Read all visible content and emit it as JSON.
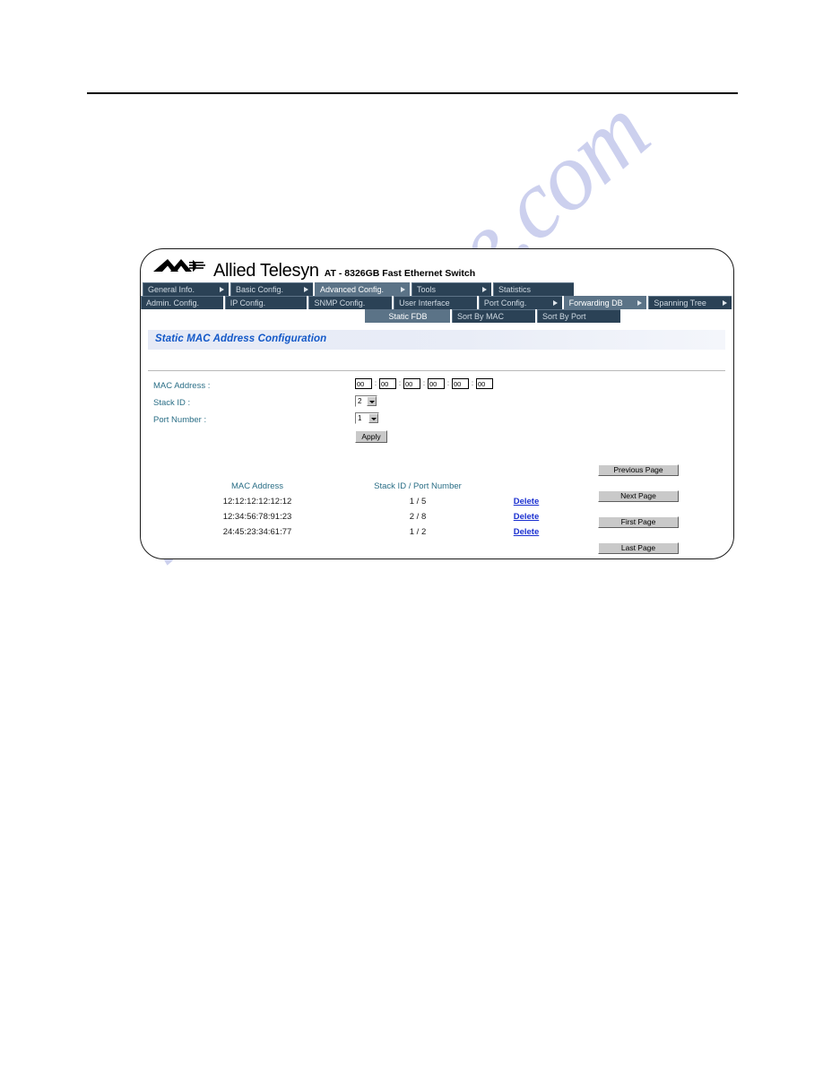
{
  "watermark": {
    "text": "manualshive.com"
  },
  "device": {
    "brand": "Allied Telesyn",
    "model": "AT - 8326GB Fast Ethernet Switch",
    "logo_icon": "allied-telesyn-logo-icon"
  },
  "nav": {
    "row1": [
      {
        "label": "General Info.",
        "selected": false,
        "arrow": true
      },
      {
        "label": "Basic Config.",
        "selected": false,
        "arrow": true
      },
      {
        "label": "Advanced Config.",
        "selected": true,
        "arrow": true
      },
      {
        "label": "Tools",
        "selected": false,
        "arrow": true
      },
      {
        "label": "Statistics",
        "selected": false,
        "arrow": false
      }
    ],
    "row2": [
      {
        "label": "Admin. Config.",
        "selected": false,
        "arrow": false
      },
      {
        "label": "IP Config.",
        "selected": false,
        "arrow": false
      },
      {
        "label": "SNMP Config.",
        "selected": false,
        "arrow": false
      },
      {
        "label": "User Interface",
        "selected": false,
        "arrow": false
      },
      {
        "label": "Port Config.",
        "selected": false,
        "arrow": true
      },
      {
        "label": "Forwarding DB",
        "selected": true,
        "arrow": true
      },
      {
        "label": "Spanning Tree",
        "selected": false,
        "arrow": true
      }
    ],
    "row3": [
      {
        "label": "Static FDB",
        "selected": true,
        "arrow": false
      },
      {
        "label": "Sort By MAC",
        "selected": false,
        "arrow": false
      },
      {
        "label": "Sort By Port",
        "selected": false,
        "arrow": false
      }
    ]
  },
  "page": {
    "title": "Static MAC Address Configuration"
  },
  "form": {
    "mac_label": "MAC Address :",
    "mac_octets": [
      "00",
      "00",
      "00",
      "00",
      "00",
      "00"
    ],
    "mac_separator": ":",
    "stack_label": "Stack ID :",
    "stack_value": "2",
    "port_label": "Port Number :",
    "port_value": "1",
    "apply_label": "Apply"
  },
  "table": {
    "headers": [
      "MAC Address",
      "Stack ID / Port Number",
      ""
    ],
    "rows": [
      {
        "mac": "12:12:12:12:12:12",
        "stack_port": "1 / 5",
        "action": "Delete"
      },
      {
        "mac": "12:34:56:78:91:23",
        "stack_port": "2 / 8",
        "action": "Delete"
      },
      {
        "mac": "24:45:23:34:61:77",
        "stack_port": "1 / 2",
        "action": "Delete"
      }
    ]
  },
  "pagination": {
    "previous": "Previous Page",
    "next": "Next Page",
    "first": "First Page",
    "last": "Last Page"
  },
  "colors": {
    "nav_dark": "#2b4256",
    "nav_selected": "#5b7387",
    "title_text": "#1358c8",
    "label_text": "#2a6e86",
    "link": "#1a2fd0",
    "watermark": "#ccd0ee"
  }
}
